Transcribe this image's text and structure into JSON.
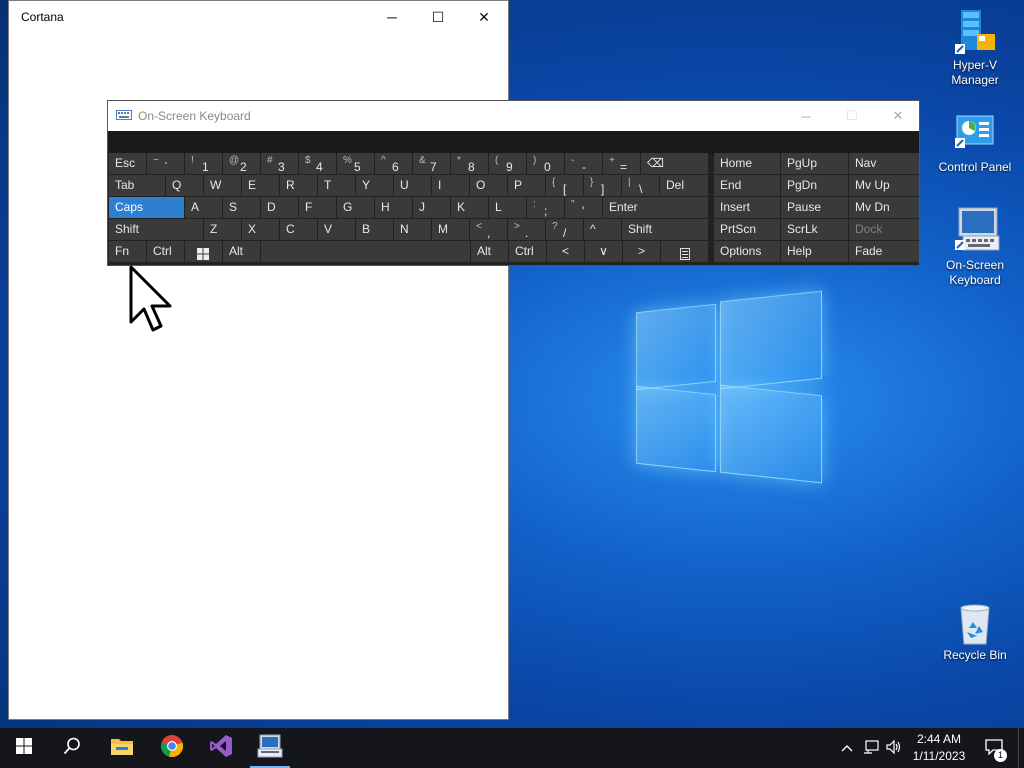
{
  "desktop": {
    "icons": [
      {
        "label": "Hyper-V Manager",
        "icon": "hyper-v-manager-icon"
      },
      {
        "label": "Control Panel",
        "icon": "control-panel-icon"
      },
      {
        "label": "On-Screen Keyboard",
        "icon": "on-screen-keyboard-icon"
      },
      {
        "label": "Recycle Bin",
        "icon": "recycle-bin-icon"
      }
    ]
  },
  "cortana": {
    "title": "Cortana",
    "minimize": "─",
    "maximize": "☐",
    "close": "✕"
  },
  "osk": {
    "title": "On-Screen Keyboard",
    "minimize": "─",
    "maximize": "☐",
    "close": "✕",
    "row1": {
      "esc": "Esc",
      "k1s": "~",
      "k1m": "`",
      "k2s": "!",
      "k2m": "1",
      "k3s": "@",
      "k3m": "2",
      "k4s": "#",
      "k4m": "3",
      "k5s": "$",
      "k5m": "4",
      "k6s": "%",
      "k6m": "5",
      "k7s": "^",
      "k7m": "6",
      "k8s": "&",
      "k8m": "7",
      "k9s": "*",
      "k9m": "8",
      "k10s": "(",
      "k10m": "9",
      "k11s": ")",
      "k11m": "0",
      "k12s": "-",
      "k12m": "-",
      "k13s": "+",
      "k13m": "=",
      "bksp": "⌫"
    },
    "row2": {
      "tab": "Tab",
      "q": "Q",
      "w": "W",
      "e": "E",
      "r": "R",
      "t": "T",
      "y": "Y",
      "u": "U",
      "i": "I",
      "o": "O",
      "p": "P",
      "lbs": "{",
      "lbm": "[",
      "rbs": "}",
      "rbm": "]",
      "bss": "|",
      "bsm": "\\",
      "del": "Del"
    },
    "row3": {
      "caps": "Caps",
      "a": "A",
      "s": "S",
      "d": "D",
      "f": "F",
      "g": "G",
      "h": "H",
      "j": "J",
      "k": "K",
      "l": "L",
      "scs": ":",
      "scm": ";",
      "qs": "\"",
      "qm": "'",
      "enter": "Enter"
    },
    "row4": {
      "shift": "Shift",
      "z": "Z",
      "x": "X",
      "c": "C",
      "v": "V",
      "b": "B",
      "n": "N",
      "m": "M",
      "cms": "<",
      "cmm": ",",
      "pds": ">",
      "pdm": ".",
      "sls": "?",
      "slm": "/",
      "up": "^",
      "shift2": "Shift"
    },
    "row5": {
      "fn": "Fn",
      "ctrl": "Ctrl",
      "alt": "Alt",
      "alt2": "Alt",
      "ctrl2": "Ctrl",
      "left": "<",
      "down": "∨",
      "right": ">"
    },
    "nav": {
      "home": "Home",
      "pgup": "PgUp",
      "navk": "Nav",
      "end": "End",
      "pgdn": "PgDn",
      "mvup": "Mv Up",
      "insert": "Insert",
      "pause": "Pause",
      "mvdn": "Mv Dn",
      "prtscn": "PrtScn",
      "scrlk": "ScrLk",
      "dock": "Dock",
      "options": "Options",
      "help": "Help",
      "fade": "Fade"
    }
  },
  "taskbar": {
    "time": "2:44 AM",
    "date": "1/11/2023",
    "notification_count": "1",
    "colors": {
      "background": "#14161c",
      "accent": "#2d7fd0"
    }
  }
}
